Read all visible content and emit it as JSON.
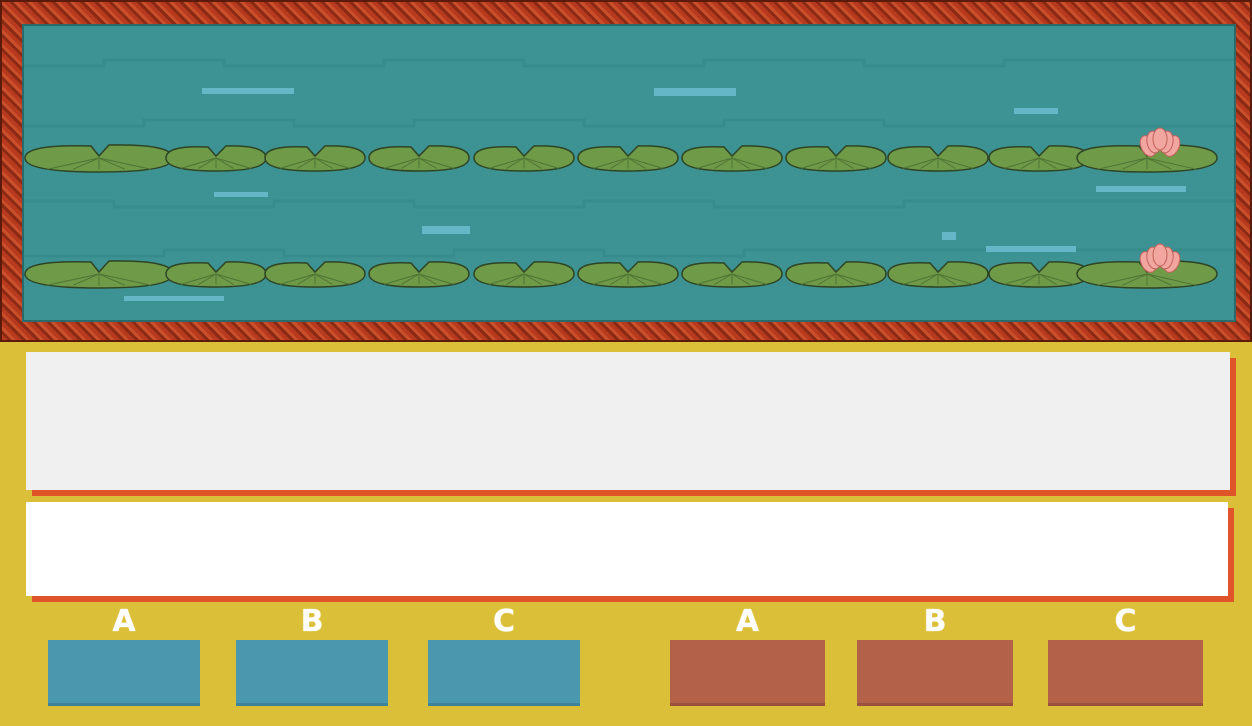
{
  "question": {
    "text": ""
  },
  "answer": {
    "text": ""
  },
  "teams": [
    {
      "team": "blue",
      "color": "#4b97ad",
      "options": [
        {
          "letter": "A"
        },
        {
          "letter": "B"
        },
        {
          "letter": "C"
        }
      ]
    },
    {
      "team": "red",
      "color": "#b4614a",
      "options": [
        {
          "letter": "A"
        },
        {
          "letter": "B"
        },
        {
          "letter": "C"
        }
      ]
    }
  ],
  "colors": {
    "background": "#dcbf38",
    "pond_water": "#3d9393",
    "frame": "#b83a1e",
    "lily_pad": "#6f9a48",
    "lotus": "#f2a6a0",
    "panel_shadow": "#e0542a"
  },
  "icons": [
    "lily-pad-icon",
    "lotus-flower-icon"
  ]
}
